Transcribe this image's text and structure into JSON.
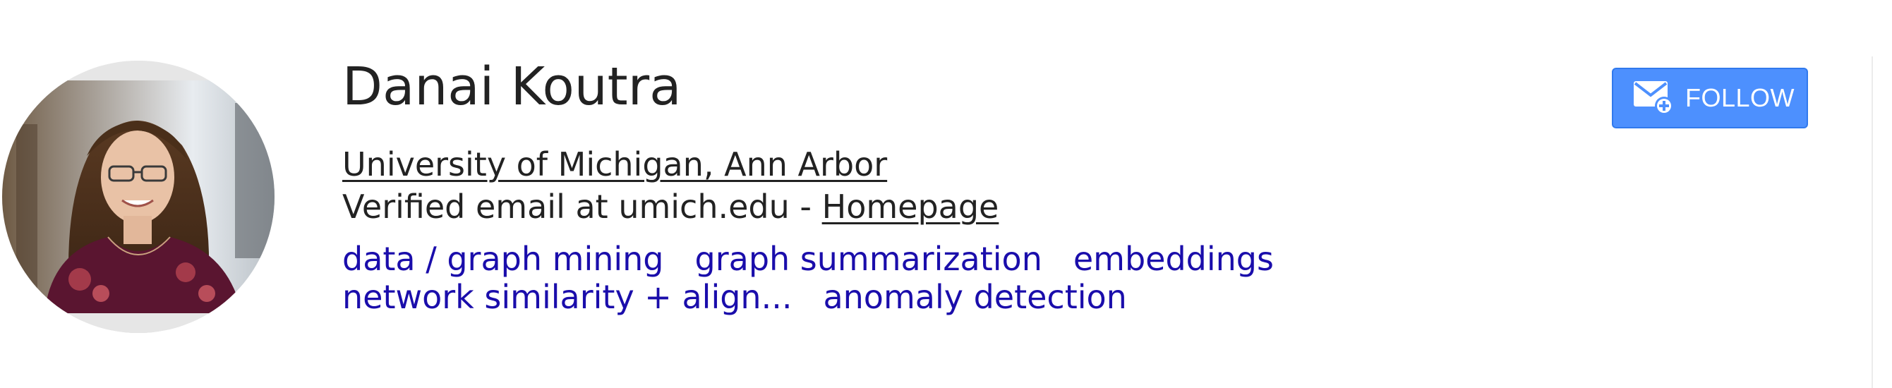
{
  "profile": {
    "name": "Danai Koutra",
    "affiliation": "University of Michigan, Ann Arbor",
    "email_text": "Verified email at umich.edu - ",
    "homepage_label": "Homepage",
    "photo_icon": "profile-photo"
  },
  "interests": [
    "data / graph mining",
    "graph summarization",
    "embeddings",
    "network similarity + align...",
    "anomaly detection"
  ],
  "follow_button": {
    "label": "FOLLOW",
    "icon": "mail-plus-icon",
    "color": "#4d90fe"
  },
  "colors": {
    "link": "#1a0dab",
    "text": "#222222"
  }
}
